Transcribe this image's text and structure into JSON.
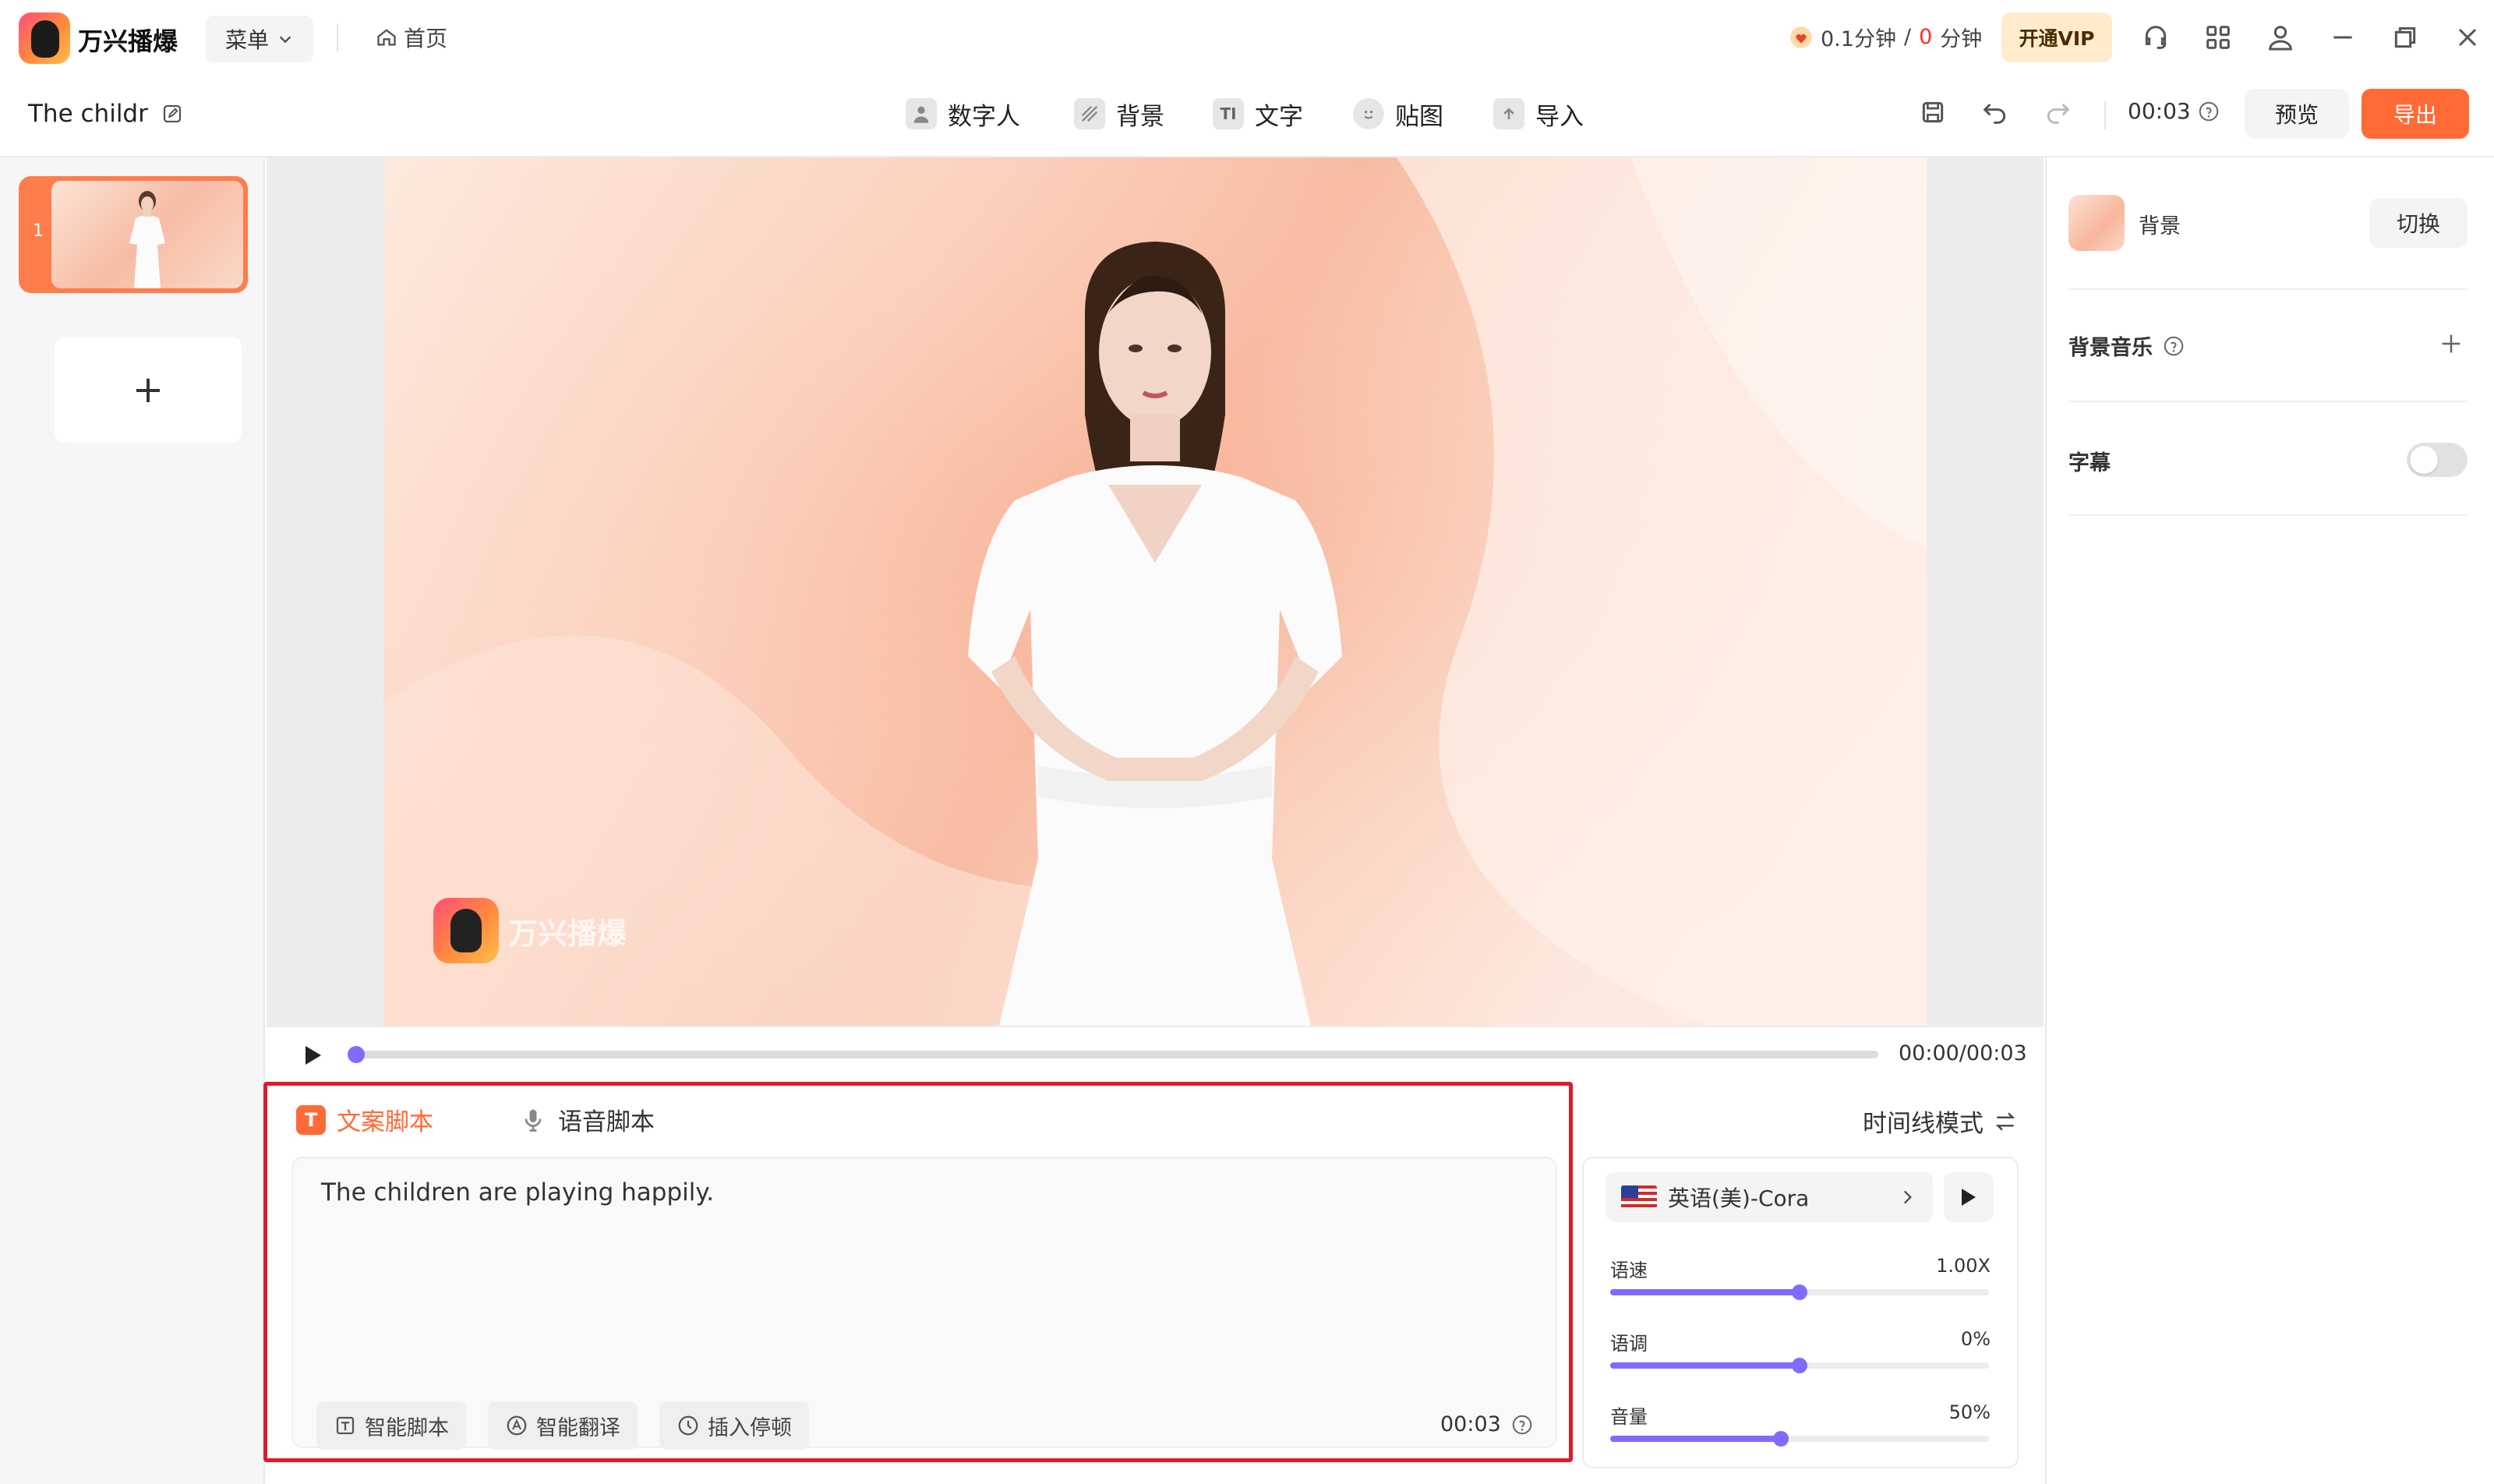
{
  "app": {
    "name": "万兴播爆"
  },
  "titlebar": {
    "menu_label": "菜单",
    "home_label": "首页",
    "minutes_used": "0.1分钟",
    "minutes_sep": "/",
    "minutes_left": "0",
    "minutes_unit": "分钟",
    "vip_label": "开通VIP"
  },
  "toolbar": {
    "project_title": "The childr",
    "tools": [
      {
        "label": "数字人",
        "icon": "avatar-icon"
      },
      {
        "label": "背景",
        "icon": "background-icon"
      },
      {
        "label": "文字",
        "icon": "text-icon"
      },
      {
        "label": "贴图",
        "icon": "sticker-icon"
      },
      {
        "label": "导入",
        "icon": "import-icon"
      }
    ],
    "duration": "00:03",
    "preview_label": "预览",
    "export_label": "导出"
  },
  "slides": {
    "items": [
      {
        "number": "1"
      }
    ],
    "add_label": "+"
  },
  "canvas": {
    "watermark": "万兴播爆"
  },
  "playback": {
    "timecode": "00:00/00:03",
    "progress": 0.0
  },
  "script": {
    "tab_text": "文案脚本",
    "tab_text_badge": "T",
    "tab_voice": "语音脚本",
    "content": "The children are playing happily.",
    "buttons": [
      "智能脚本",
      "智能翻译",
      "插入停顿"
    ],
    "duration": "00:03"
  },
  "voice": {
    "timeline_mode": "时间线模式",
    "voice_name": "英语(美)-Cora",
    "sliders": [
      {
        "label": "语速",
        "value": "1.00X",
        "level": 0.5
      },
      {
        "label": "语调",
        "value": "0%",
        "level": 0.5
      },
      {
        "label": "音量",
        "value": "50%",
        "level": 0.45
      }
    ]
  },
  "rightpanel": {
    "background_label": "背景",
    "switch_label": "切换",
    "music_label": "背景音乐",
    "subtitle_label": "字幕",
    "subtitle_on": false
  },
  "colors": {
    "accent": "#ff6a36",
    "slider": "#7f6cff",
    "highlight_box": "#e01a26"
  }
}
